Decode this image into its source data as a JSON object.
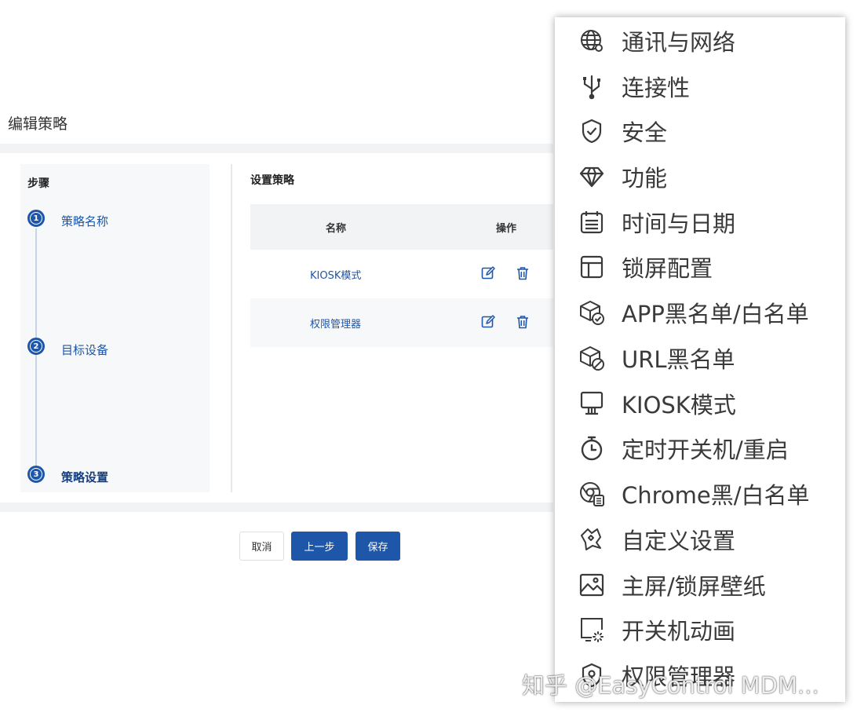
{
  "page": {
    "title": "编辑策略"
  },
  "steps": {
    "title": "步骤",
    "items": [
      {
        "num": "1",
        "label": "策略名称"
      },
      {
        "num": "2",
        "label": "目标设备"
      },
      {
        "num": "3",
        "label": "策略设置"
      }
    ]
  },
  "policy": {
    "title": "设置策略",
    "columns": [
      "名称",
      "操作"
    ],
    "rows": [
      {
        "name": "KIOSK模式",
        "actions": [
          "edit-icon",
          "delete-icon"
        ]
      },
      {
        "name": "权限管理器",
        "actions": [
          "edit-icon",
          "delete-icon"
        ]
      }
    ]
  },
  "buttons": {
    "cancel": "取消",
    "prev": "上一步",
    "save": "保存"
  },
  "menu": {
    "items": [
      {
        "icon": "globe-icon",
        "label": "通讯与网络"
      },
      {
        "icon": "usb-icon",
        "label": "连接性"
      },
      {
        "icon": "shield-check-icon",
        "label": "安全"
      },
      {
        "icon": "diamond-icon",
        "label": "功能"
      },
      {
        "icon": "calendar-icon",
        "label": "时间与日期"
      },
      {
        "icon": "layout-icon",
        "label": "锁屏配置"
      },
      {
        "icon": "app-box-check-icon",
        "label": "APP黑名单/白名单"
      },
      {
        "icon": "app-box-block-icon",
        "label": "URL黑名单"
      },
      {
        "icon": "kiosk-monitor-icon",
        "label": "KIOSK模式"
      },
      {
        "icon": "timer-icon",
        "label": "定时开关机/重启"
      },
      {
        "icon": "chrome-list-icon",
        "label": "Chrome黑/白名单"
      },
      {
        "icon": "custom-settings-icon",
        "label": "自定义设置"
      },
      {
        "icon": "image-icon",
        "label": "主屏/锁屏壁纸"
      },
      {
        "icon": "boot-animation-icon",
        "label": "开关机动画"
      },
      {
        "icon": "permission-shield-icon",
        "label": "权限管理器"
      }
    ]
  },
  "watermark": "知乎 @EasyControl MDM...",
  "colors": {
    "primary": "#1e56a9",
    "icon": "#3a3a3a"
  }
}
